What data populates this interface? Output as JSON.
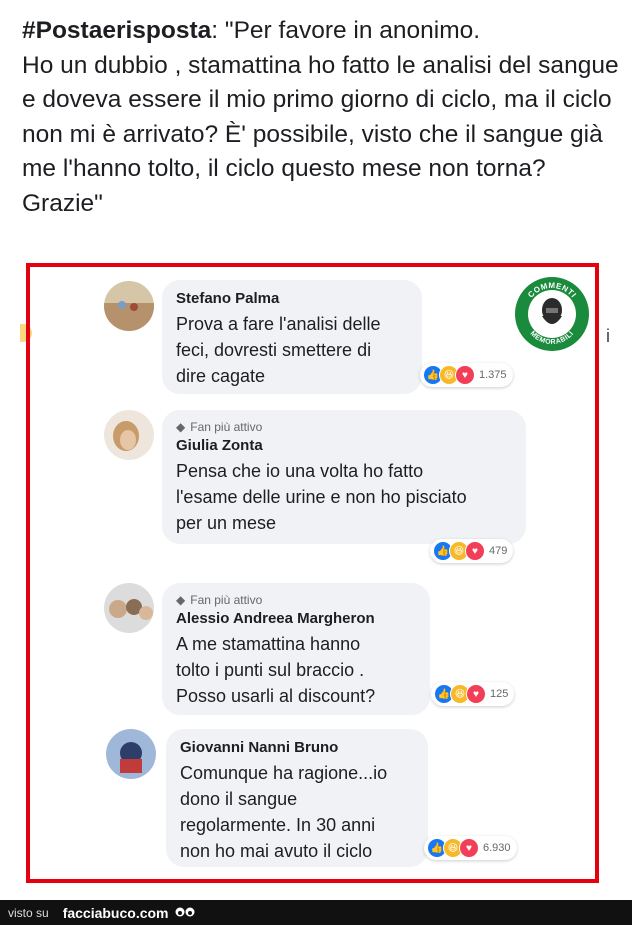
{
  "post": {
    "hashtag": "#Postaerisposta",
    "body": ": \"Per favore in anonimo.\nHo un dubbio , stamattina ho fatto le analisi del sangue e doveva essere il mio primo giorno di ciclo, ma il ciclo non mi è arrivato? È' possibile, visto che il sangue già me l'hanno tolto, il ciclo questo mese non torna?\nGrazie\""
  },
  "logo": {
    "top_text": "COMMENTI",
    "bottom_text": "MEMORABILI",
    "colors": {
      "ring": "#1a8a3c",
      "inner": "#ffffff"
    }
  },
  "comments": [
    {
      "name": "Stefano Palma",
      "badge": "",
      "text": "Prova a fare l'analisi delle\nfeci, dovresti smettere di\ndire cagate",
      "count": "1.375",
      "avatar_colors": [
        "#b5926b",
        "#7a9cc6"
      ]
    },
    {
      "name": "Giulia Zonta",
      "badge": "Fan più attivo",
      "text": "Pensa che io una volta ho fatto\nl'esame delle urine e non ho pisciato\nper un mese",
      "count": "479",
      "avatar_colors": [
        "#d8b48c",
        "#6b4a32"
      ]
    },
    {
      "name": "Alessio Andreea Margheron",
      "badge": "Fan più attivo",
      "text": "A me stamattina hanno\ntolto i punti sul braccio .\nPosso usarli al discount?",
      "count": "125",
      "avatar_colors": [
        "#c9a98a",
        "#8a6d55"
      ]
    },
    {
      "name": "Giovanni Nanni Bruno",
      "badge": "",
      "text": "Comunque ha ragione...io\ndono il sangue\nregolarmente. In 30 anni\nnon ho mai avuto il ciclo",
      "count": "6.930",
      "avatar_colors": [
        "#2d3e6b",
        "#c23b3b"
      ]
    }
  ],
  "footer": {
    "visto": "visto su",
    "site": "facciabuco.com"
  },
  "colors": {
    "frame": "#e3000f",
    "bubble": "#f0f2f5",
    "like": "#1877f2",
    "haha": "#f7b928",
    "love": "#f33e58"
  }
}
